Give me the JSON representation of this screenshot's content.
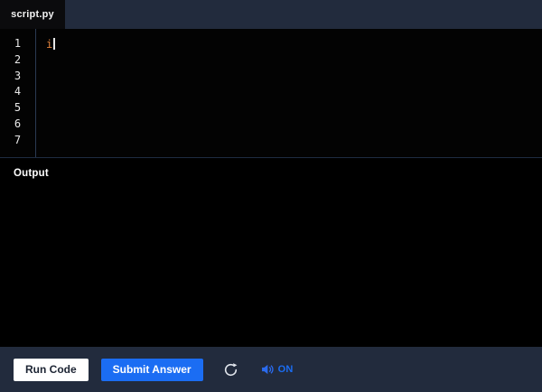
{
  "tabbar": {
    "tab_title": "script.py"
  },
  "editor": {
    "line_numbers": [
      "1",
      "2",
      "3",
      "4",
      "5",
      "6",
      "7"
    ],
    "code_line1": "i",
    "cursor_visible": true
  },
  "output": {
    "label": "Output"
  },
  "toolbar": {
    "run_label": "Run Code",
    "submit_label": "Submit Answer",
    "sound_state": "ON"
  },
  "icons": {
    "refresh": "refresh-icon",
    "speaker": "speaker-on-icon"
  },
  "colors": {
    "blue": "#1B6DF3",
    "orange": "#E0823C",
    "navy": "#222B3D",
    "tab_bg": "#0B0B0D",
    "editor_bg": "#030303",
    "output_bg": "#000000",
    "divider": "#2B3A52",
    "divider2": "#1E2C42"
  }
}
